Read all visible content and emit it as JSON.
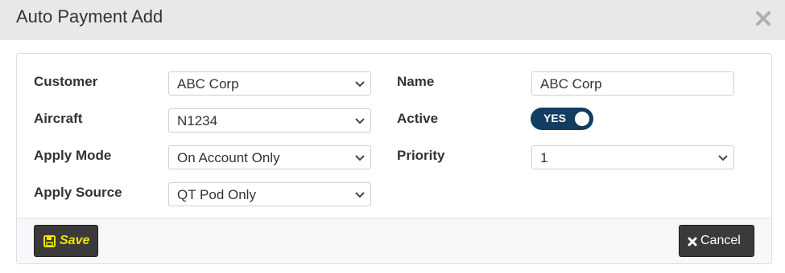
{
  "dialog": {
    "title": "Auto Payment Add"
  },
  "form": {
    "customer": {
      "label": "Customer",
      "value": "ABC Corp"
    },
    "aircraft": {
      "label": "Aircraft",
      "value": "N1234"
    },
    "apply_mode": {
      "label": "Apply Mode",
      "value": "On Account Only"
    },
    "apply_source": {
      "label": "Apply Source",
      "value": "QT Pod Only"
    },
    "name": {
      "label": "Name",
      "value": "ABC Corp"
    },
    "active": {
      "label": "Active",
      "toggle_text": "YES",
      "on": true
    },
    "priority": {
      "label": "Priority",
      "value": "1"
    }
  },
  "footer": {
    "save_label": "Save",
    "cancel_label": "Cancel"
  },
  "colors": {
    "title_bar_bg": "#e8e8e8",
    "toggle_on": "#123c60",
    "save_text": "#f2e600",
    "button_bg": "#3a3a3a"
  }
}
